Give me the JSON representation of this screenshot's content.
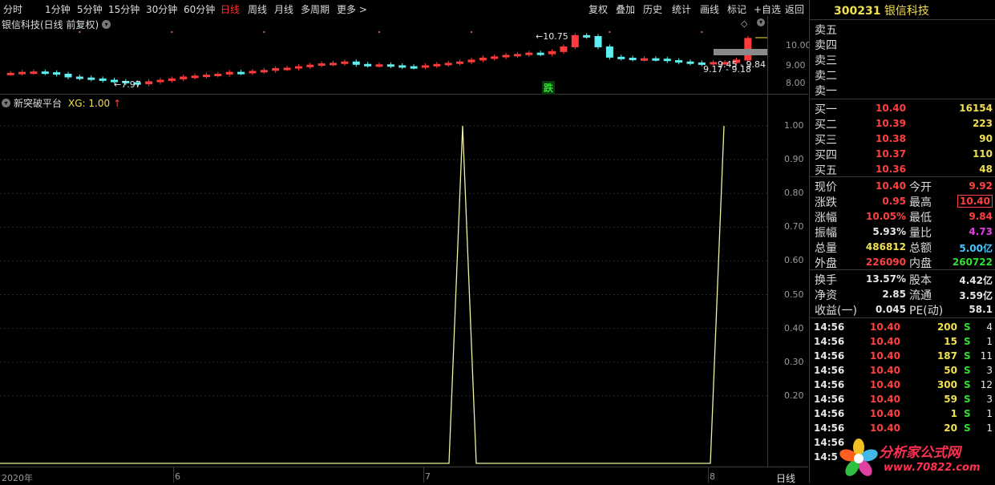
{
  "toolbar": {
    "tabs": [
      "分时",
      "1分钟",
      "5分钟",
      "15分钟",
      "30分钟",
      "60分钟",
      "日线",
      "周线",
      "月线",
      "多周期",
      "更多 >"
    ],
    "active_tab": "日线",
    "actions": [
      "复权",
      "叠加",
      "历史",
      "统计",
      "画线",
      "标记",
      "+自选",
      "返回"
    ]
  },
  "price_chart": {
    "title": "银信科技(日线 前复权)",
    "high_label": "10.75",
    "low_label": "7.97",
    "range_label_1": "9.45 - 9.84",
    "range_label_2": "9.17 - 9.18",
    "fall_badge": "跌",
    "y_ticks": [
      "10.00",
      "9.00",
      "8.00"
    ],
    "colors": {
      "up": "#ff3b3b",
      "down": "#5ef0f0",
      "background": "#000000"
    }
  },
  "indicator": {
    "title": "新突破平台",
    "xg_label": "XG: 1.00",
    "arrow": "↑",
    "y_ticks": [
      "1.00",
      "0.90",
      "0.80",
      "0.70",
      "0.60",
      "0.50",
      "0.40",
      "0.30",
      "0.20"
    ],
    "line_color": "#f0f0a0"
  },
  "x_axis": {
    "labels": [
      "2020年",
      "6",
      "7",
      "8"
    ],
    "period_label": "日线"
  },
  "chart_data": {
    "type": "line",
    "title": "",
    "series": [
      {
        "name": "XG",
        "values": [
          0,
          0,
          0,
          0,
          0,
          0,
          0,
          0,
          0,
          0,
          0,
          0,
          0,
          0,
          0,
          0,
          0,
          0,
          0,
          0,
          0,
          0,
          0,
          0,
          0,
          0,
          0,
          0,
          0,
          0,
          0,
          0,
          0,
          0,
          0,
          0,
          1,
          0,
          0,
          0,
          0,
          0,
          0,
          0,
          0,
          0,
          0,
          0,
          0,
          0,
          0,
          0,
          0,
          0,
          0,
          0,
          0,
          1
        ]
      }
    ],
    "ylim": [
      0,
      1.05
    ]
  },
  "panel": {
    "code": "300231",
    "name": "银信科技",
    "sell": [
      {
        "label": "卖五",
        "price": "",
        "vol": ""
      },
      {
        "label": "卖四",
        "price": "",
        "vol": ""
      },
      {
        "label": "卖三",
        "price": "",
        "vol": ""
      },
      {
        "label": "卖二",
        "price": "",
        "vol": ""
      },
      {
        "label": "卖一",
        "price": "",
        "vol": ""
      }
    ],
    "buy": [
      {
        "label": "买一",
        "price": "10.40",
        "vol": "16154"
      },
      {
        "label": "买二",
        "price": "10.39",
        "vol": "223"
      },
      {
        "label": "买三",
        "price": "10.38",
        "vol": "90"
      },
      {
        "label": "买四",
        "price": "10.37",
        "vol": "110"
      },
      {
        "label": "买五",
        "price": "10.36",
        "vol": "48"
      }
    ],
    "stats": [
      {
        "l1": "现价",
        "v1": "10.40",
        "c1": "red",
        "l2": "今开",
        "v2": "9.92",
        "c2": "red"
      },
      {
        "l1": "涨跌",
        "v1": "0.95",
        "c1": "red",
        "l2": "最高",
        "v2": "10.40",
        "c2": "red"
      },
      {
        "l1": "涨幅",
        "v1": "10.05%",
        "c1": "red",
        "l2": "最低",
        "v2": "9.84",
        "c2": "red"
      },
      {
        "l1": "振幅",
        "v1": "5.93%",
        "c1": "white",
        "l2": "量比",
        "v2": "4.73",
        "c2": "magenta"
      },
      {
        "l1": "总量",
        "v1": "486812",
        "c1": "yellow",
        "l2": "总额",
        "v2": "5.00亿",
        "c2": "cyan"
      },
      {
        "l1": "外盘",
        "v1": "226090",
        "c1": "red",
        "l2": "内盘",
        "v2": "260722",
        "c2": "green"
      }
    ],
    "stats2": [
      {
        "l1": "换手",
        "v1": "13.57%",
        "l2": "股本",
        "v2": "4.42亿"
      },
      {
        "l1": "净资",
        "v1": "2.85",
        "l2": "流通",
        "v2": "3.59亿"
      },
      {
        "l1": "收益(一)",
        "v1": "0.045",
        "l2": "PE(动)",
        "v2": "58.1"
      }
    ],
    "ticks": [
      {
        "time": "14:56",
        "price": "10.40",
        "vol": "200",
        "side": "S",
        "n": "4"
      },
      {
        "time": "14:56",
        "price": "10.40",
        "vol": "15",
        "side": "S",
        "n": "1"
      },
      {
        "time": "14:56",
        "price": "10.40",
        "vol": "187",
        "side": "S",
        "n": "11"
      },
      {
        "time": "14:56",
        "price": "10.40",
        "vol": "50",
        "side": "S",
        "n": "3"
      },
      {
        "time": "14:56",
        "price": "10.40",
        "vol": "300",
        "side": "S",
        "n": "12"
      },
      {
        "time": "14:56",
        "price": "10.40",
        "vol": "59",
        "side": "S",
        "n": "3"
      },
      {
        "time": "14:56",
        "price": "10.40",
        "vol": "1",
        "side": "S",
        "n": "1"
      },
      {
        "time": "14:56",
        "price": "10.40",
        "vol": "20",
        "side": "S",
        "n": "1"
      },
      {
        "time": "14:56",
        "price": "",
        "vol": "",
        "side": "",
        "n": ""
      },
      {
        "time": "14:5",
        "price": "",
        "vol": "",
        "side": "",
        "n": ""
      }
    ]
  },
  "watermark": {
    "line1": "分析家公式网",
    "line2": "www.70822.com"
  }
}
